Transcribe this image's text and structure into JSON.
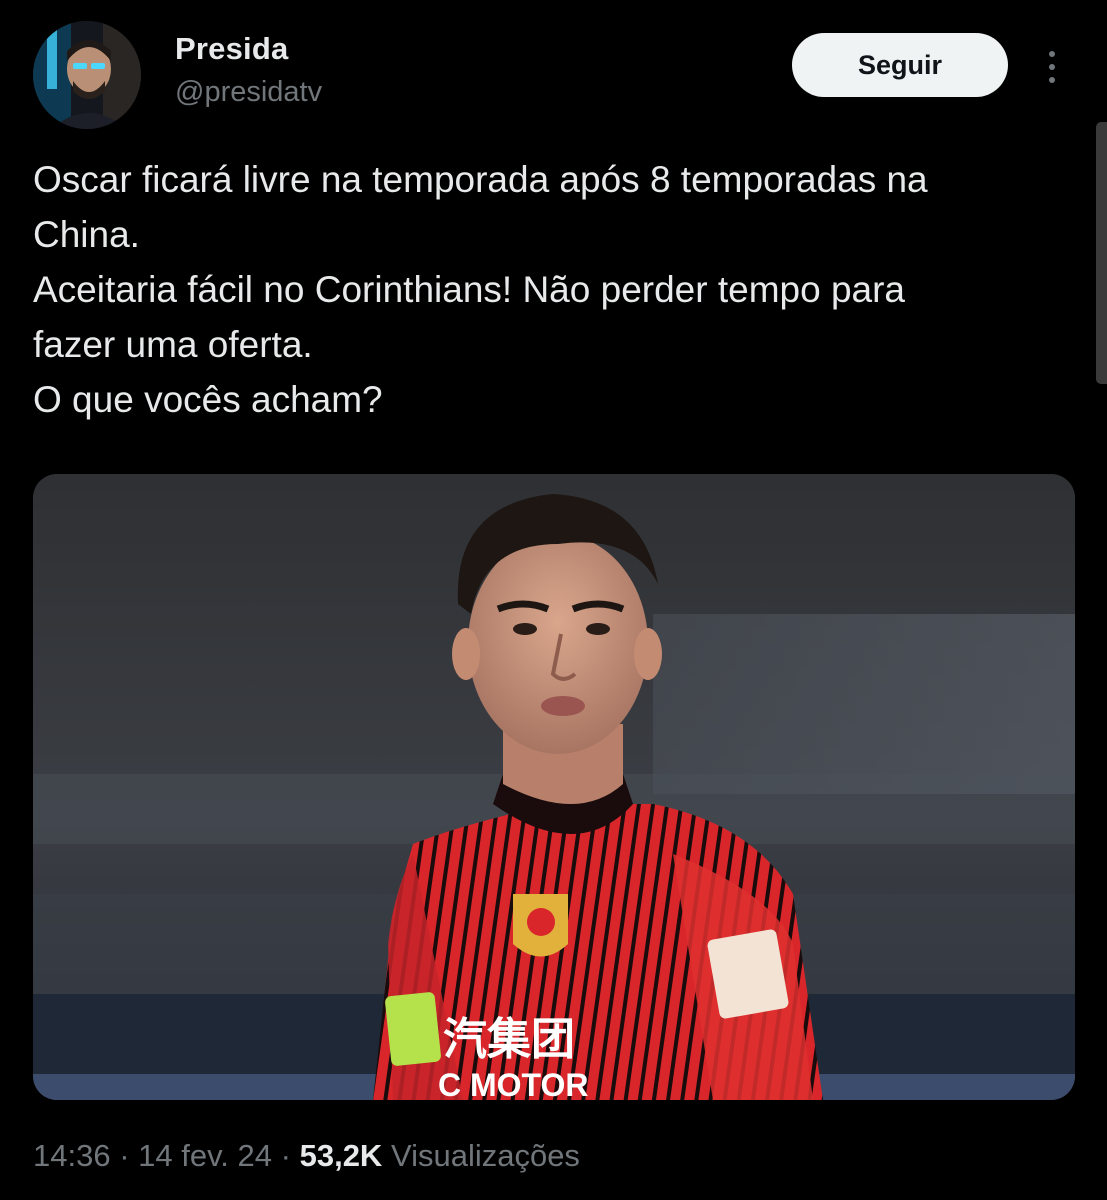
{
  "author": {
    "display_name": "Presida",
    "handle": "@presidatv"
  },
  "actions": {
    "follow_label": "Seguir",
    "more_icon": "more-vertical-icon"
  },
  "tweet": {
    "lines": [
      "Oscar ficará livre na temporada após 8 temporadas na",
      "China.",
      "Aceitaria fácil no Corinthians! Não perder tempo para",
      "fazer uma oferta.",
      "O que vocês acham?"
    ]
  },
  "media": {
    "shirt_text_chinese": "汽集团",
    "shirt_text_latin": "C MOTOR"
  },
  "footer": {
    "time": "14:36",
    "separator": "·",
    "date": "14 fev. 24",
    "views_count": "53,2K",
    "views_label": "Visualizações"
  },
  "colors": {
    "background": "#000000",
    "text_primary": "#e7e9ea",
    "text_secondary": "#71767b",
    "button_bg": "#eff3f4",
    "jersey_red": "#d8262b"
  }
}
